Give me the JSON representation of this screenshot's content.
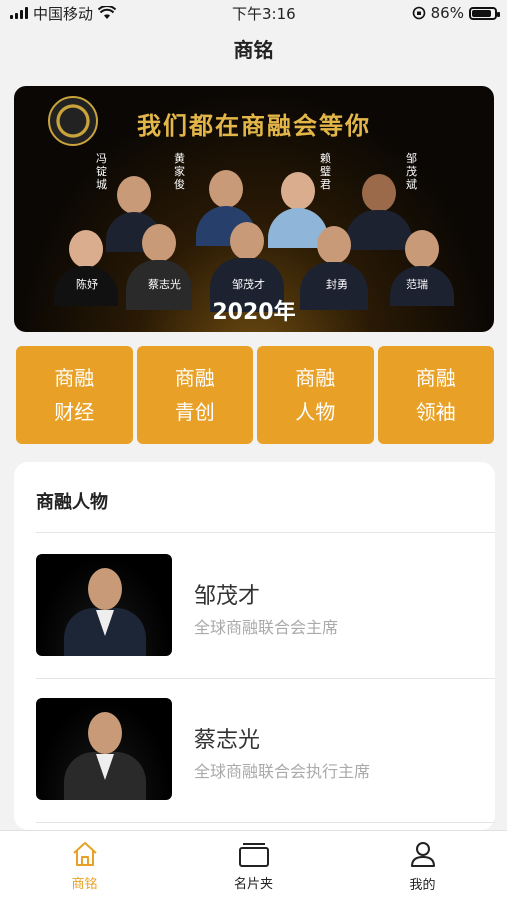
{
  "status_bar": {
    "carrier": "中国移动",
    "time": "下午3:16",
    "battery": "86%",
    "battery_level": 0.86
  },
  "header": {
    "title": "商铭"
  },
  "banner": {
    "headline": "我们都在商融会等你",
    "year": "2020年",
    "names": [
      "冯锭城",
      "黄家俊",
      "赖璧君",
      "邹茂斌",
      "陈妤",
      "蔡志光",
      "邹茂才",
      "封勇",
      "范瑞"
    ]
  },
  "categories": [
    {
      "line1": "商融",
      "line2": "财经"
    },
    {
      "line1": "商融",
      "line2": "青创"
    },
    {
      "line1": "商融",
      "line2": "人物"
    },
    {
      "line1": "商融",
      "line2": "领袖"
    }
  ],
  "section": {
    "title": "商融人物",
    "people": [
      {
        "name": "邹茂才",
        "role": "全球商融联合会主席"
      },
      {
        "name": "蔡志光",
        "role": "全球商融联合会执行主席"
      }
    ]
  },
  "tabs": [
    {
      "label": "商铭",
      "icon": "home-icon",
      "active": true
    },
    {
      "label": "名片夹",
      "icon": "cards-icon",
      "active": false
    },
    {
      "label": "我的",
      "icon": "user-icon",
      "active": false
    }
  ],
  "colors": {
    "accent": "#e8a126",
    "banner_gold": "#e3b64a"
  }
}
